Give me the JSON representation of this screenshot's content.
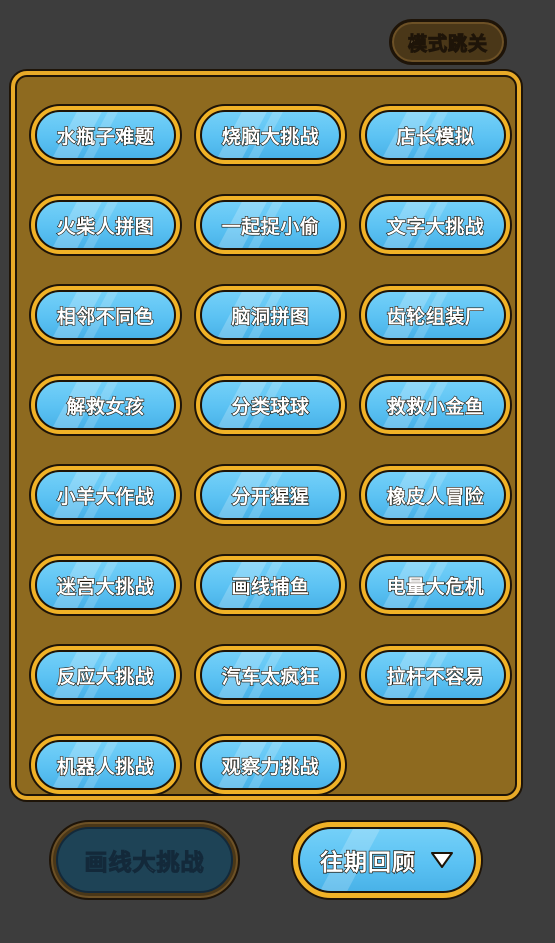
{
  "header": {
    "mode_skip_label": "模式跳关"
  },
  "games": [
    {
      "label": "水瓶子难题"
    },
    {
      "label": "烧脑大挑战"
    },
    {
      "label": "店长模拟"
    },
    {
      "label": "火柴人拼图"
    },
    {
      "label": "一起捉小偷"
    },
    {
      "label": "文字大挑战"
    },
    {
      "label": "相邻不同色"
    },
    {
      "label": "脑洞拼图"
    },
    {
      "label": "齿轮组装厂"
    },
    {
      "label": "解救女孩"
    },
    {
      "label": "分类球球"
    },
    {
      "label": "救救小金鱼"
    },
    {
      "label": "小羊大作战"
    },
    {
      "label": "分开猩猩"
    },
    {
      "label": "橡皮人冒险"
    },
    {
      "label": "迷宫大挑战"
    },
    {
      "label": "画线捕鱼"
    },
    {
      "label": "电量大危机"
    },
    {
      "label": "反应大挑战"
    },
    {
      "label": "汽车太疯狂"
    },
    {
      "label": "拉杆不容易"
    },
    {
      "label": "机器人挑战"
    },
    {
      "label": "观察力挑战"
    }
  ],
  "footer": {
    "draw_challenge_label": "画线大挑战",
    "history_label": "往期回顾",
    "history_icon": "chevron-down-icon"
  },
  "colors": {
    "background": "#3d3d3d",
    "board_frame": "#e8aa28",
    "board_fill": "#8e6a1f",
    "button_blue": "#5bc2f3",
    "outline": "#1e1408"
  }
}
